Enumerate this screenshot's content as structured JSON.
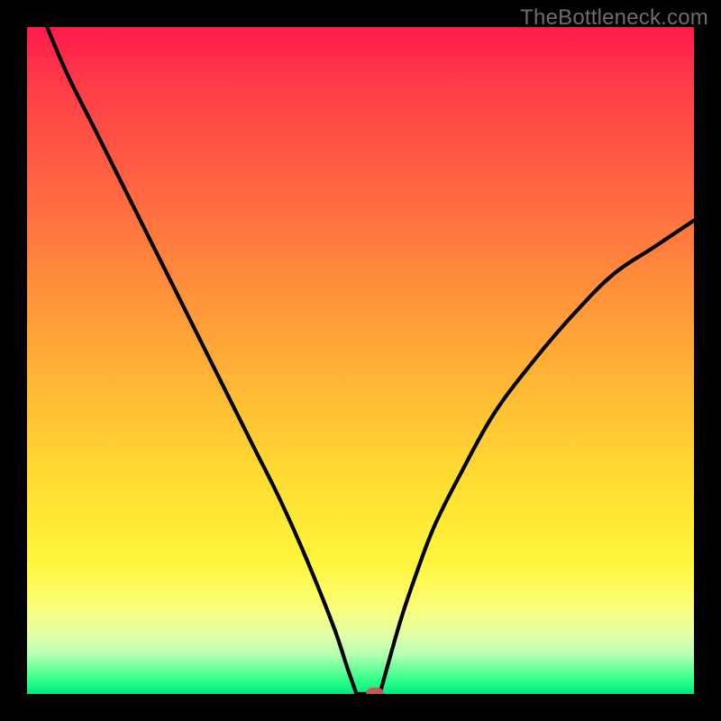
{
  "watermark": "TheBottleneck.com",
  "colors": {
    "frame": "#000000",
    "curve": "#000000",
    "marker": "#c45a54",
    "gradient_top": "#ff1a4b",
    "gradient_bottom": "#03e97b"
  },
  "chart_data": {
    "type": "line",
    "title": "",
    "xlabel": "",
    "ylabel": "",
    "xlim": [
      0,
      100
    ],
    "ylim": [
      0,
      100
    ],
    "annotations": [],
    "series": [
      {
        "name": "left-branch",
        "x": [
          3,
          6,
          10,
          14,
          18,
          22,
          26,
          30,
          34,
          38,
          42,
          46,
          48,
          49.4
        ],
        "values": [
          100,
          93,
          85,
          77,
          69,
          61,
          53,
          45,
          37,
          29,
          20,
          10,
          4,
          0
        ]
      },
      {
        "name": "right-branch",
        "x": [
          52.9,
          54,
          56,
          58,
          61,
          65,
          70,
          76,
          82,
          88,
          94,
          100
        ],
        "values": [
          0,
          4,
          11,
          17,
          25,
          33,
          42,
          50,
          57,
          63,
          67,
          71
        ]
      },
      {
        "name": "flat-bottom",
        "x": [
          49.4,
          52.9
        ],
        "values": [
          0,
          0
        ]
      }
    ],
    "marker": {
      "x": 52.1,
      "y": 0
    }
  }
}
